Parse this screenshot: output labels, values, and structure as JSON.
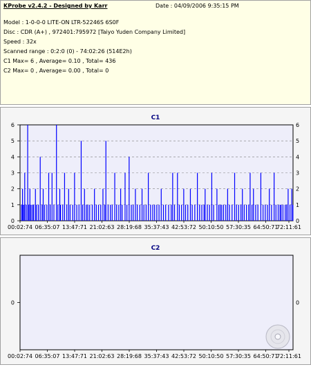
{
  "info": {
    "title": "KProbe v2.4.2 - Designed by Karr",
    "date": "Date : 04/09/2006 9:35:15 PM",
    "model": "Model : 1-0-0-0 LITE-ON LTR-52246S       6S0F",
    "disc": "Disc : CDR (A+) , 972401:795972 [Taiyo Yuden Company Limited]",
    "speed": "Speed : 32x",
    "scanned_range": "Scanned range : 0:2:0 (0) - 74:02:26 (514E2h)",
    "c1_stats": "C1 Max= 6 , Average= 0.10 , Total= 436",
    "c2_stats": "C2 Max= 0 , Average= 0.00 , Total= 0"
  },
  "colors": {
    "info_bg": "#ffffe6",
    "plot_bg": "#eeeefa",
    "bar": "#0000ff",
    "title": "#000080",
    "grid": "#808080"
  },
  "chart_data": [
    {
      "type": "bar",
      "title": "C1",
      "xlabel": "",
      "ylabel": "",
      "ylim": [
        0,
        6
      ],
      "yticks": [
        "0",
        "1",
        "2",
        "3",
        "4",
        "5",
        "6"
      ],
      "xticks": [
        "00:02:74",
        "06:35:07",
        "13:47:71",
        "21:02:63",
        "28:19:68",
        "35:37:43",
        "42:53:72",
        "50:10:50",
        "57:30:35",
        "64:50:71",
        "72:11:61"
      ],
      "x_range_minutes": [
        0.04,
        74.04
      ],
      "grid": true,
      "spikes": [
        {
          "t": 0.6,
          "v": 2
        },
        {
          "t": 1.2,
          "v": 3
        },
        {
          "t": 2.0,
          "v": 6
        },
        {
          "t": 2.6,
          "v": 2
        },
        {
          "t": 3.3,
          "v": 1
        },
        {
          "t": 4.1,
          "v": 2
        },
        {
          "t": 5.4,
          "v": 4
        },
        {
          "t": 6.2,
          "v": 2
        },
        {
          "t": 7.7,
          "v": 3
        },
        {
          "t": 8.6,
          "v": 3
        },
        {
          "t": 9.8,
          "v": 6
        },
        {
          "t": 10.7,
          "v": 2
        },
        {
          "t": 12.0,
          "v": 3
        },
        {
          "t": 13.1,
          "v": 2
        },
        {
          "t": 14.7,
          "v": 3
        },
        {
          "t": 16.5,
          "v": 5
        },
        {
          "t": 17.4,
          "v": 2
        },
        {
          "t": 18.3,
          "v": 1
        },
        {
          "t": 20.1,
          "v": 2
        },
        {
          "t": 22.4,
          "v": 2
        },
        {
          "t": 23.2,
          "v": 5
        },
        {
          "t": 24.4,
          "v": 1
        },
        {
          "t": 25.6,
          "v": 3
        },
        {
          "t": 27.2,
          "v": 2
        },
        {
          "t": 28.4,
          "v": 3
        },
        {
          "t": 29.5,
          "v": 4
        },
        {
          "t": 31.2,
          "v": 2
        },
        {
          "t": 33.0,
          "v": 2
        },
        {
          "t": 34.7,
          "v": 3
        },
        {
          "t": 36.4,
          "v": 1
        },
        {
          "t": 38.2,
          "v": 2
        },
        {
          "t": 41.3,
          "v": 3
        },
        {
          "t": 42.6,
          "v": 3
        },
        {
          "t": 44.3,
          "v": 2
        },
        {
          "t": 46.1,
          "v": 2
        },
        {
          "t": 48.0,
          "v": 3
        },
        {
          "t": 50.1,
          "v": 2
        },
        {
          "t": 51.9,
          "v": 3
        },
        {
          "t": 53.3,
          "v": 2
        },
        {
          "t": 54.6,
          "v": 1
        },
        {
          "t": 56.2,
          "v": 2
        },
        {
          "t": 58.1,
          "v": 3
        },
        {
          "t": 60.2,
          "v": 2
        },
        {
          "t": 62.3,
          "v": 3
        },
        {
          "t": 63.2,
          "v": 2
        },
        {
          "t": 65.2,
          "v": 3
        },
        {
          "t": 67.5,
          "v": 2
        },
        {
          "t": 68.8,
          "v": 3
        },
        {
          "t": 70.7,
          "v": 1
        },
        {
          "t": 72.6,
          "v": 2
        },
        {
          "t": 73.6,
          "v": 2
        }
      ],
      "baseline_ones_minutes": [
        0.3,
        0.8,
        1.1,
        1.6,
        2.3,
        2.9,
        3.6,
        4.4,
        4.9,
        5.9,
        6.6,
        7.2,
        8.1,
        9.1,
        10.2,
        10.9,
        11.5,
        12.6,
        13.5,
        14.2,
        15.3,
        15.9,
        16.9,
        17.9,
        18.8,
        19.5,
        20.6,
        21.2,
        21.8,
        22.9,
        23.8,
        24.9,
        26.1,
        26.7,
        27.6,
        28.9,
        30.1,
        30.6,
        31.7,
        32.4,
        33.5,
        34.1,
        35.3,
        35.9,
        37.0,
        37.6,
        38.8,
        39.4,
        40.2,
        40.9,
        41.8,
        43.1,
        43.7,
        44.8,
        45.4,
        46.6,
        47.3,
        48.6,
        49.2,
        49.8,
        50.7,
        51.3,
        52.4,
        53.8,
        54.2,
        55.1,
        55.7,
        56.7,
        57.4,
        58.6,
        59.2,
        59.8,
        60.7,
        61.3,
        61.9,
        62.8,
        63.8,
        64.4,
        65.8,
        66.4,
        67.0,
        68.1,
        69.3,
        69.9,
        70.4,
        71.2,
        71.8,
        72.2,
        73.1,
        73.9
      ]
    },
    {
      "type": "bar",
      "title": "C2",
      "xlabel": "",
      "ylabel": "",
      "ylim": [
        0,
        0
      ],
      "yticks": [
        "0"
      ],
      "xticks": [
        "00:02:74",
        "06:35:07",
        "13:47:71",
        "21:02:63",
        "28:19:68",
        "35:37:43",
        "42:53:72",
        "50:10:50",
        "57:30:35",
        "64:50:71",
        "72:11:61"
      ],
      "x_range_minutes": [
        0.04,
        74.04
      ],
      "grid": true,
      "values": []
    }
  ]
}
